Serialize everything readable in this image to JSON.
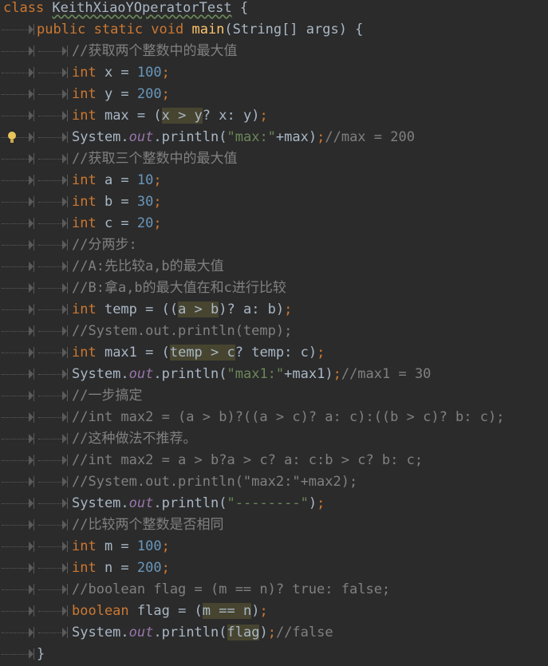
{
  "editor": {
    "lines": [
      {
        "indent": 0,
        "tokens": [
          {
            "t": "class ",
            "c": "kw"
          },
          {
            "t": "KeithXiaoYOperatorTest",
            "c": "plain squiggle"
          },
          {
            "t": " {",
            "c": "plain"
          }
        ]
      },
      {
        "indent": 1,
        "tokens": [
          {
            "t": "public static void ",
            "c": "kw"
          },
          {
            "t": "main",
            "c": "fn"
          },
          {
            "t": "(String[] args) {",
            "c": "plain"
          }
        ]
      },
      {
        "indent": 2,
        "tokens": [
          {
            "t": "//获取两个整数中的最大值",
            "c": "cm"
          }
        ]
      },
      {
        "indent": 2,
        "tokens": [
          {
            "t": "int ",
            "c": "kw"
          },
          {
            "t": "x = ",
            "c": "plain"
          },
          {
            "t": "100",
            "c": "num"
          },
          {
            "t": ";",
            "c": "kw"
          }
        ]
      },
      {
        "indent": 2,
        "tokens": [
          {
            "t": "int ",
            "c": "kw"
          },
          {
            "t": "y = ",
            "c": "plain"
          },
          {
            "t": "200",
            "c": "num"
          },
          {
            "t": ";",
            "c": "kw"
          }
        ]
      },
      {
        "indent": 2,
        "tokens": [
          {
            "t": "int ",
            "c": "kw"
          },
          {
            "t": "max = (",
            "c": "plain"
          },
          {
            "t": "x > y",
            "c": "plain hl"
          },
          {
            "t": "? x: y)",
            "c": "plain"
          },
          {
            "t": ";",
            "c": "kw"
          }
        ]
      },
      {
        "indent": 2,
        "bulb": true,
        "tokens": [
          {
            "t": "System.",
            "c": "plain"
          },
          {
            "t": "out",
            "c": "fld"
          },
          {
            "t": ".println(",
            "c": "plain"
          },
          {
            "t": "\"max:\"",
            "c": "str"
          },
          {
            "t": "+max)",
            "c": "plain"
          },
          {
            "t": ";",
            "c": "kw"
          },
          {
            "t": "//max = 200",
            "c": "cm"
          }
        ]
      },
      {
        "indent": 2,
        "tokens": [
          {
            "t": "//获取三个整数中的最大值",
            "c": "cm"
          }
        ]
      },
      {
        "indent": 2,
        "tokens": [
          {
            "t": "int ",
            "c": "kw"
          },
          {
            "t": "a = ",
            "c": "plain"
          },
          {
            "t": "10",
            "c": "num"
          },
          {
            "t": ";",
            "c": "kw"
          }
        ]
      },
      {
        "indent": 2,
        "tokens": [
          {
            "t": "int ",
            "c": "kw"
          },
          {
            "t": "b = ",
            "c": "plain"
          },
          {
            "t": "30",
            "c": "num"
          },
          {
            "t": ";",
            "c": "kw"
          }
        ]
      },
      {
        "indent": 2,
        "tokens": [
          {
            "t": "int ",
            "c": "kw"
          },
          {
            "t": "c = ",
            "c": "plain"
          },
          {
            "t": "20",
            "c": "num"
          },
          {
            "t": ";",
            "c": "kw"
          }
        ]
      },
      {
        "indent": 2,
        "tokens": [
          {
            "t": "//分两步:",
            "c": "cm"
          }
        ]
      },
      {
        "indent": 2,
        "tokens": [
          {
            "t": "//A:先比较a,b的最大值",
            "c": "cm"
          }
        ]
      },
      {
        "indent": 2,
        "tokens": [
          {
            "t": "//B:拿a,b的最大值在和c进行比较",
            "c": "cm"
          }
        ]
      },
      {
        "indent": 2,
        "tokens": [
          {
            "t": "int ",
            "c": "kw"
          },
          {
            "t": "temp = ((",
            "c": "plain"
          },
          {
            "t": "a > b",
            "c": "plain hl"
          },
          {
            "t": ")? a: b)",
            "c": "plain"
          },
          {
            "t": ";",
            "c": "kw"
          }
        ]
      },
      {
        "indent": 2,
        "tokens": [
          {
            "t": "//System.out.println(temp);",
            "c": "cm"
          }
        ]
      },
      {
        "indent": 2,
        "tokens": [
          {
            "t": "int ",
            "c": "kw"
          },
          {
            "t": "max1 = (",
            "c": "plain"
          },
          {
            "t": "temp > c",
            "c": "plain hl"
          },
          {
            "t": "? temp: c)",
            "c": "plain"
          },
          {
            "t": ";",
            "c": "kw"
          }
        ]
      },
      {
        "indent": 2,
        "tokens": [
          {
            "t": "System.",
            "c": "plain"
          },
          {
            "t": "out",
            "c": "fld"
          },
          {
            "t": ".println(",
            "c": "plain"
          },
          {
            "t": "\"max1:\"",
            "c": "str"
          },
          {
            "t": "+max1)",
            "c": "plain"
          },
          {
            "t": ";",
            "c": "kw"
          },
          {
            "t": "//max1 = 30",
            "c": "cm"
          }
        ]
      },
      {
        "indent": 2,
        "tokens": [
          {
            "t": "//一步搞定",
            "c": "cm"
          }
        ]
      },
      {
        "indent": 2,
        "tokens": [
          {
            "t": "//int max2 = (a > b)?((a > c)? a: c):((b > c)? b: c);",
            "c": "cm"
          }
        ]
      },
      {
        "indent": 2,
        "tokens": [
          {
            "t": "//这种做法不推荐。",
            "c": "cm"
          }
        ]
      },
      {
        "indent": 2,
        "tokens": [
          {
            "t": "//int max2 = a > b?a > c? a: c:b > c? b: c;",
            "c": "cm"
          }
        ]
      },
      {
        "indent": 2,
        "tokens": [
          {
            "t": "//System.out.println(\"max2:\"+max2);",
            "c": "cm"
          }
        ]
      },
      {
        "indent": 2,
        "tokens": [
          {
            "t": "System.",
            "c": "plain"
          },
          {
            "t": "out",
            "c": "fld"
          },
          {
            "t": ".println(",
            "c": "plain"
          },
          {
            "t": "\"--------\"",
            "c": "str"
          },
          {
            "t": ")",
            "c": "plain"
          },
          {
            "t": ";",
            "c": "kw"
          }
        ]
      },
      {
        "indent": 2,
        "tokens": [
          {
            "t": "//比较两个整数是否相同",
            "c": "cm"
          }
        ]
      },
      {
        "indent": 2,
        "tokens": [
          {
            "t": "int ",
            "c": "kw"
          },
          {
            "t": "m = ",
            "c": "plain"
          },
          {
            "t": "100",
            "c": "num"
          },
          {
            "t": ";",
            "c": "kw"
          }
        ]
      },
      {
        "indent": 2,
        "tokens": [
          {
            "t": "int ",
            "c": "kw"
          },
          {
            "t": "n = ",
            "c": "plain"
          },
          {
            "t": "200",
            "c": "num"
          },
          {
            "t": ";",
            "c": "kw"
          }
        ]
      },
      {
        "indent": 2,
        "tokens": [
          {
            "t": "//boolean flag = (m == n)? true: false;",
            "c": "cm"
          }
        ]
      },
      {
        "indent": 2,
        "tokens": [
          {
            "t": "boolean ",
            "c": "kw"
          },
          {
            "t": "flag = (",
            "c": "plain"
          },
          {
            "t": "m == n",
            "c": "plain hl"
          },
          {
            "t": ")",
            "c": "plain"
          },
          {
            "t": ";",
            "c": "kw"
          }
        ]
      },
      {
        "indent": 2,
        "tokens": [
          {
            "t": "System.",
            "c": "plain"
          },
          {
            "t": "out",
            "c": "fld"
          },
          {
            "t": ".println(",
            "c": "plain"
          },
          {
            "t": "flag",
            "c": "plain hl"
          },
          {
            "t": ")",
            "c": "plain"
          },
          {
            "t": ";",
            "c": "kw"
          },
          {
            "t": "//false",
            "c": "cm"
          }
        ]
      },
      {
        "indent": 1,
        "tokens": [
          {
            "t": "}",
            "c": "plain"
          }
        ]
      }
    ]
  },
  "icons": {
    "gutter_hint": "lightbulb-icon"
  },
  "colors": {
    "background": "#2b2b2b",
    "keyword": "#cc7832",
    "method": "#ffc66d",
    "number": "#6897bb",
    "string": "#6a8759",
    "comment": "#808080",
    "field": "#9876aa",
    "text": "#a9b7c6"
  }
}
